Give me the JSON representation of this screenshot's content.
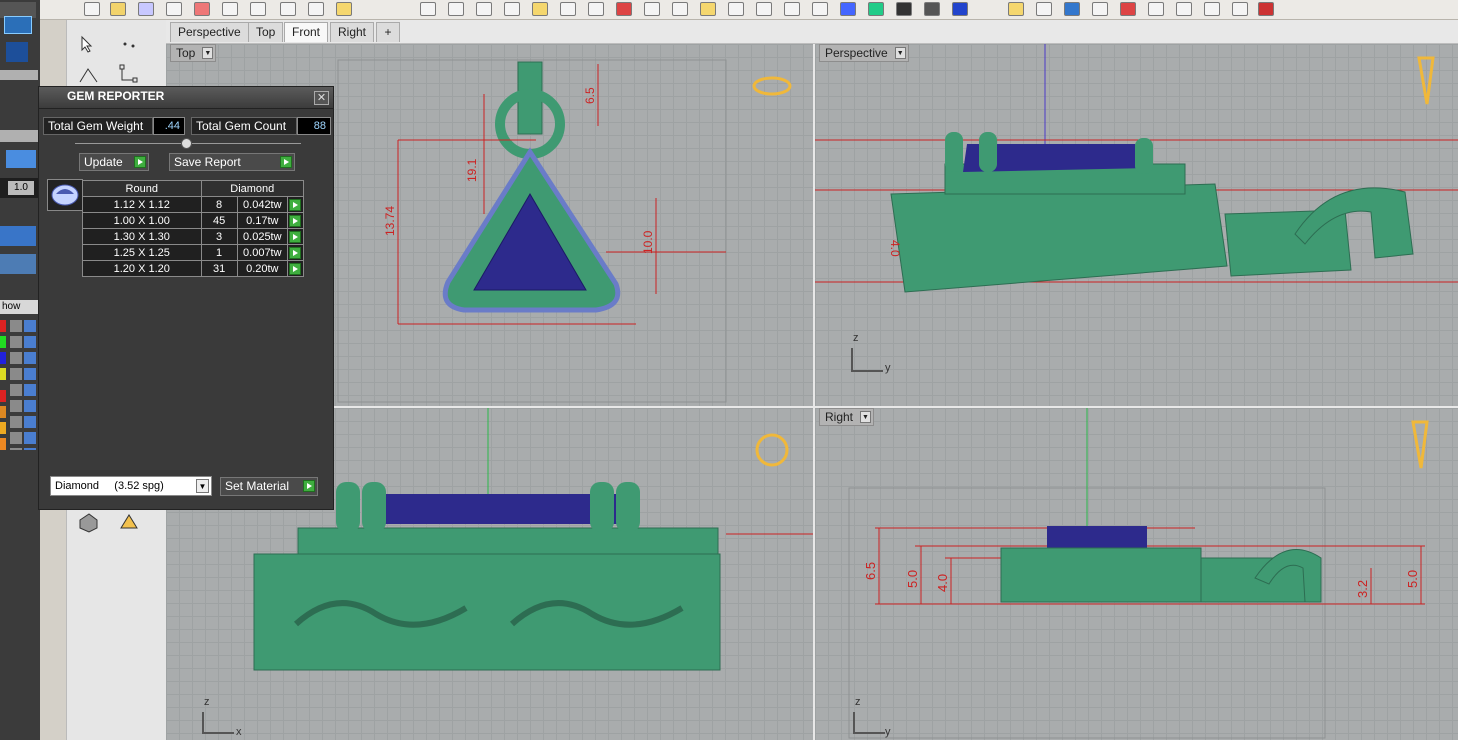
{
  "tabs": [
    "Perspective",
    "Top",
    "Front",
    "Right"
  ],
  "active_tab": "Front",
  "viewports": {
    "top": {
      "label": "Top"
    },
    "perspective": {
      "label": "Perspective"
    },
    "right": {
      "label": "Right"
    }
  },
  "axes": {
    "z": "z",
    "x": "x",
    "y": "y"
  },
  "dimensions": {
    "top": [
      "6.5",
      "13.74",
      "19.1",
      "10.0"
    ],
    "perspective": [
      "4.0"
    ],
    "right": [
      "6.5",
      "5.0",
      "4.0",
      "3.2",
      "5.0"
    ]
  },
  "left_panel": {
    "field_value": "1.0",
    "show_label": "how"
  },
  "gem_reporter": {
    "title": "GEM REPORTER",
    "total_weight_label": "Total Gem Weight",
    "total_weight_value": ".44",
    "total_count_label": "Total Gem Count",
    "total_count_value": "88",
    "update_label": "Update",
    "save_label": "Save Report",
    "table_headers": [
      "Round",
      "Diamond"
    ],
    "rows": [
      {
        "size": "1.12 X 1.12",
        "count": "8",
        "weight": "0.042tw"
      },
      {
        "size": "1.00 X 1.00",
        "count": "45",
        "weight": "0.17tw"
      },
      {
        "size": "1.30 X 1.30",
        "count": "3",
        "weight": "0.025tw"
      },
      {
        "size": "1.25 X 1.25",
        "count": "1",
        "weight": "0.007tw"
      },
      {
        "size": "1.20 X 1.20",
        "count": "31",
        "weight": "0.20tw"
      }
    ],
    "material_value": "Diamond     (3.52 spg)",
    "set_material_label": "Set Material"
  },
  "colors": {
    "model_green": "#3f9a72",
    "gem_blue": "#2d2a8c",
    "dimension_red": "#cc2222",
    "viewport_bg": "#a9acad"
  }
}
